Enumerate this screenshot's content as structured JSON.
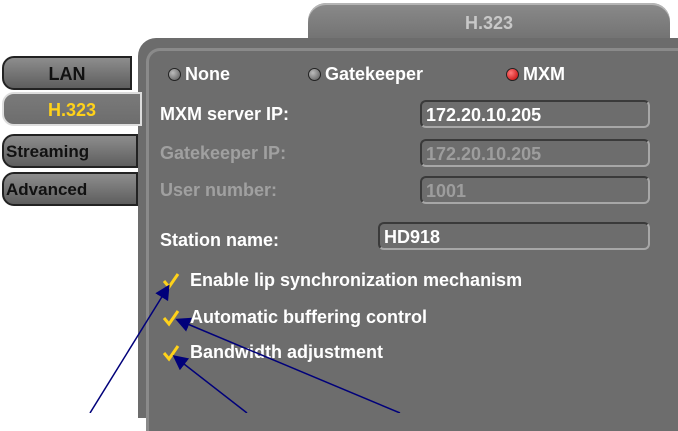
{
  "title_tab": "H.323",
  "side_tabs": [
    {
      "label": "LAN"
    },
    {
      "label": "H.323"
    },
    {
      "label": "Streaming"
    },
    {
      "label": "Advanced"
    }
  ],
  "radios": [
    {
      "label": "None",
      "selected": false
    },
    {
      "label": "Gatekeeper",
      "selected": false
    },
    {
      "label": "MXM",
      "selected": true
    }
  ],
  "fields": {
    "mxm_ip": {
      "label": "MXM server IP:",
      "value": "172.20.10.205",
      "enabled": true
    },
    "gatekeeper_ip": {
      "label": "Gatekeeper IP:",
      "value": "172.20.10.205",
      "enabled": false
    },
    "user_number": {
      "label": "User number:",
      "value": "1001",
      "enabled": false
    },
    "station_name": {
      "label": "Station name:",
      "value": "HD918",
      "enabled": true
    }
  },
  "checkboxes": [
    {
      "label": "Enable lip synchronization mechanism",
      "checked": true
    },
    {
      "label": "Automatic buffering control",
      "checked": true
    },
    {
      "label": "Bandwidth adjustment",
      "checked": true
    }
  ],
  "colors": {
    "active_tab_text": "#ffd21a",
    "selected_radio": "#c00000",
    "check_mark": "#ffd21a",
    "annotation_arrows": "#00007a"
  }
}
